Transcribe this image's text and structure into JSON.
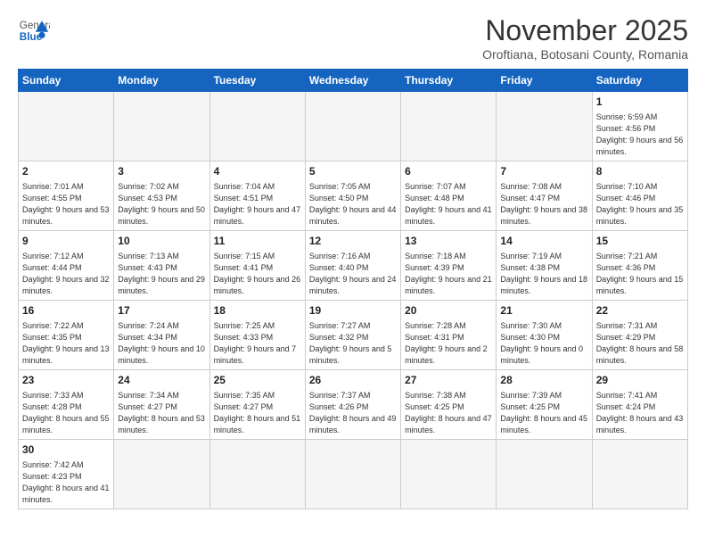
{
  "header": {
    "logo_general": "General",
    "logo_blue": "Blue",
    "month_title": "November 2025",
    "subtitle": "Oroftiana, Botosani County, Romania"
  },
  "weekdays": [
    "Sunday",
    "Monday",
    "Tuesday",
    "Wednesday",
    "Thursday",
    "Friday",
    "Saturday"
  ],
  "weeks": [
    [
      {
        "day": "",
        "info": ""
      },
      {
        "day": "",
        "info": ""
      },
      {
        "day": "",
        "info": ""
      },
      {
        "day": "",
        "info": ""
      },
      {
        "day": "",
        "info": ""
      },
      {
        "day": "",
        "info": ""
      },
      {
        "day": "1",
        "info": "Sunrise: 6:59 AM\nSunset: 4:56 PM\nDaylight: 9 hours\nand 56 minutes."
      }
    ],
    [
      {
        "day": "2",
        "info": "Sunrise: 7:01 AM\nSunset: 4:55 PM\nDaylight: 9 hours\nand 53 minutes."
      },
      {
        "day": "3",
        "info": "Sunrise: 7:02 AM\nSunset: 4:53 PM\nDaylight: 9 hours\nand 50 minutes."
      },
      {
        "day": "4",
        "info": "Sunrise: 7:04 AM\nSunset: 4:51 PM\nDaylight: 9 hours\nand 47 minutes."
      },
      {
        "day": "5",
        "info": "Sunrise: 7:05 AM\nSunset: 4:50 PM\nDaylight: 9 hours\nand 44 minutes."
      },
      {
        "day": "6",
        "info": "Sunrise: 7:07 AM\nSunset: 4:48 PM\nDaylight: 9 hours\nand 41 minutes."
      },
      {
        "day": "7",
        "info": "Sunrise: 7:08 AM\nSunset: 4:47 PM\nDaylight: 9 hours\nand 38 minutes."
      },
      {
        "day": "8",
        "info": "Sunrise: 7:10 AM\nSunset: 4:46 PM\nDaylight: 9 hours\nand 35 minutes."
      }
    ],
    [
      {
        "day": "9",
        "info": "Sunrise: 7:12 AM\nSunset: 4:44 PM\nDaylight: 9 hours\nand 32 minutes."
      },
      {
        "day": "10",
        "info": "Sunrise: 7:13 AM\nSunset: 4:43 PM\nDaylight: 9 hours\nand 29 minutes."
      },
      {
        "day": "11",
        "info": "Sunrise: 7:15 AM\nSunset: 4:41 PM\nDaylight: 9 hours\nand 26 minutes."
      },
      {
        "day": "12",
        "info": "Sunrise: 7:16 AM\nSunset: 4:40 PM\nDaylight: 9 hours\nand 24 minutes."
      },
      {
        "day": "13",
        "info": "Sunrise: 7:18 AM\nSunset: 4:39 PM\nDaylight: 9 hours\nand 21 minutes."
      },
      {
        "day": "14",
        "info": "Sunrise: 7:19 AM\nSunset: 4:38 PM\nDaylight: 9 hours\nand 18 minutes."
      },
      {
        "day": "15",
        "info": "Sunrise: 7:21 AM\nSunset: 4:36 PM\nDaylight: 9 hours\nand 15 minutes."
      }
    ],
    [
      {
        "day": "16",
        "info": "Sunrise: 7:22 AM\nSunset: 4:35 PM\nDaylight: 9 hours\nand 13 minutes."
      },
      {
        "day": "17",
        "info": "Sunrise: 7:24 AM\nSunset: 4:34 PM\nDaylight: 9 hours\nand 10 minutes."
      },
      {
        "day": "18",
        "info": "Sunrise: 7:25 AM\nSunset: 4:33 PM\nDaylight: 9 hours\nand 7 minutes."
      },
      {
        "day": "19",
        "info": "Sunrise: 7:27 AM\nSunset: 4:32 PM\nDaylight: 9 hours\nand 5 minutes."
      },
      {
        "day": "20",
        "info": "Sunrise: 7:28 AM\nSunset: 4:31 PM\nDaylight: 9 hours\nand 2 minutes."
      },
      {
        "day": "21",
        "info": "Sunrise: 7:30 AM\nSunset: 4:30 PM\nDaylight: 9 hours\nand 0 minutes."
      },
      {
        "day": "22",
        "info": "Sunrise: 7:31 AM\nSunset: 4:29 PM\nDaylight: 8 hours\nand 58 minutes."
      }
    ],
    [
      {
        "day": "23",
        "info": "Sunrise: 7:33 AM\nSunset: 4:28 PM\nDaylight: 8 hours\nand 55 minutes."
      },
      {
        "day": "24",
        "info": "Sunrise: 7:34 AM\nSunset: 4:27 PM\nDaylight: 8 hours\nand 53 minutes."
      },
      {
        "day": "25",
        "info": "Sunrise: 7:35 AM\nSunset: 4:27 PM\nDaylight: 8 hours\nand 51 minutes."
      },
      {
        "day": "26",
        "info": "Sunrise: 7:37 AM\nSunset: 4:26 PM\nDaylight: 8 hours\nand 49 minutes."
      },
      {
        "day": "27",
        "info": "Sunrise: 7:38 AM\nSunset: 4:25 PM\nDaylight: 8 hours\nand 47 minutes."
      },
      {
        "day": "28",
        "info": "Sunrise: 7:39 AM\nSunset: 4:25 PM\nDaylight: 8 hours\nand 45 minutes."
      },
      {
        "day": "29",
        "info": "Sunrise: 7:41 AM\nSunset: 4:24 PM\nDaylight: 8 hours\nand 43 minutes."
      }
    ],
    [
      {
        "day": "30",
        "info": "Sunrise: 7:42 AM\nSunset: 4:23 PM\nDaylight: 8 hours\nand 41 minutes."
      },
      {
        "day": "",
        "info": ""
      },
      {
        "day": "",
        "info": ""
      },
      {
        "day": "",
        "info": ""
      },
      {
        "day": "",
        "info": ""
      },
      {
        "day": "",
        "info": ""
      },
      {
        "day": "",
        "info": ""
      }
    ]
  ]
}
